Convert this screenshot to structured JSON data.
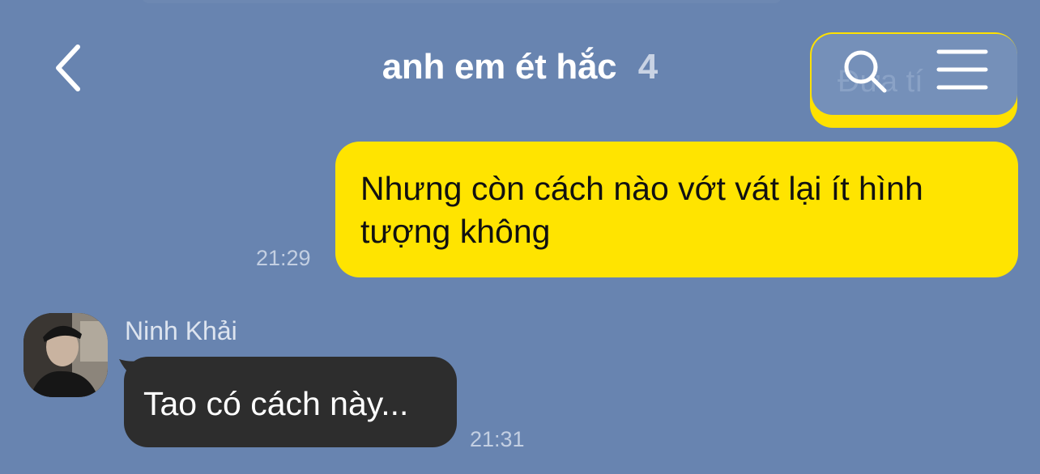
{
  "chat": {
    "title": "anh em ét hắc",
    "member_count": "4",
    "previous_message_fragment": "Đưa tí"
  },
  "header_icons": {
    "back": "chevron-left-icon",
    "search": "search-icon",
    "menu": "hamburger-menu-icon"
  },
  "messages": [
    {
      "direction": "outgoing",
      "text": "Nhưng còn cách nào vớt vát lại ít hình tượng không",
      "time": "21:29"
    },
    {
      "direction": "incoming",
      "sender": "Ninh Khải",
      "text": "Tao có cách này...",
      "time": "21:31"
    }
  ],
  "colors": {
    "background": "#6884b0",
    "outgoing_bubble": "#ffe400",
    "incoming_bubble": "#2d2d2d",
    "timestamp": "#c3cfe2"
  }
}
